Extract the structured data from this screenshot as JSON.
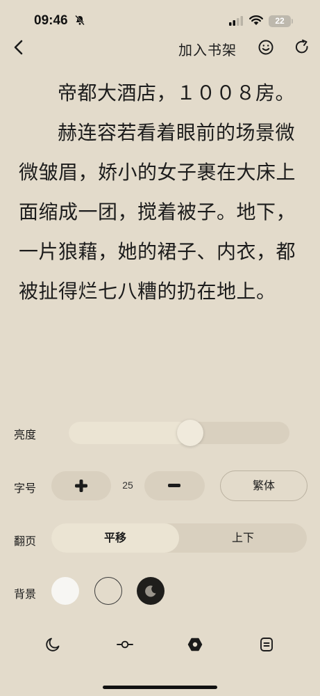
{
  "status_bar": {
    "time": "09:46",
    "battery": "22",
    "icons": [
      "bell-off-icon",
      "signal-icon",
      "wifi-icon",
      "battery-icon"
    ]
  },
  "nav": {
    "back_icon": "chevron-left-icon",
    "add_shelf_label": "加入书架",
    "smile_icon": "smile-icon",
    "refresh_icon": "refresh-icon"
  },
  "content": {
    "paragraphs": [
      "帝都大酒店，１００８房。",
      "赫连容若看着眼前的场景微微皱眉，娇小的女子裹在大床上面缩成一团，搅着被子。地下，一片狼藉，她的裙子、内衣，都被扯得烂七八糟的扔在地上。"
    ]
  },
  "settings": {
    "brightness": {
      "label": "亮度",
      "level": 0.55
    },
    "font_size": {
      "label": "字号",
      "value": "25",
      "increase_icon": "plus-icon",
      "decrease_icon": "minus-icon",
      "traditional_label": "繁体"
    },
    "page_turn": {
      "label": "翻页",
      "options": [
        "平移",
        "上下"
      ],
      "selected": "平移"
    },
    "background": {
      "label": "背景",
      "options": [
        "white",
        "cream",
        "dark"
      ],
      "selected": "cream",
      "colors": {
        "white": "#f7f6f3",
        "cream": "#e3dbcb",
        "dark": "#1f1e1c"
      }
    }
  },
  "tab_bar": {
    "icons": [
      "moon-icon",
      "progress-icon",
      "settings-hex-icon",
      "catalog-icon"
    ],
    "active": "settings-hex-icon"
  },
  "colors": {
    "page_background": "#e3dbcb",
    "control_background": "#d9d0bf",
    "control_active": "#ebe4d3",
    "text": "#1c1c1c"
  }
}
